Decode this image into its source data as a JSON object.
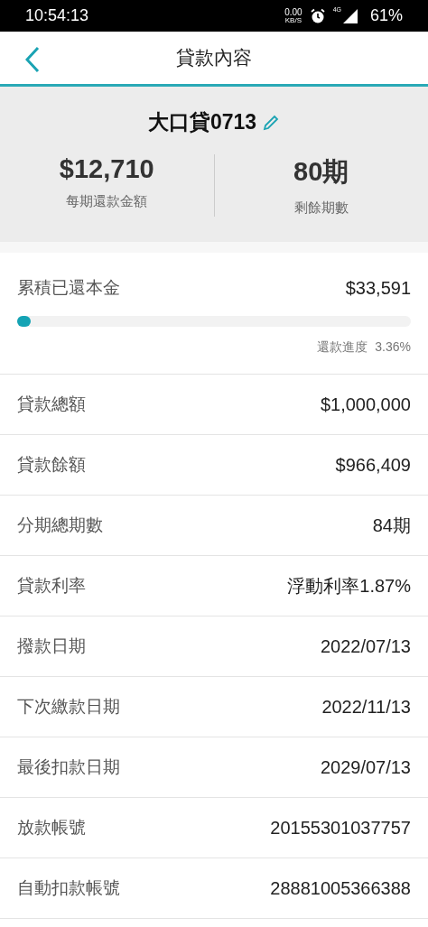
{
  "status_bar": {
    "time": "10:54:13",
    "net_speed": "0.00",
    "net_unit": "KB/S",
    "network": "4G",
    "battery": "61%"
  },
  "header": {
    "title": "貸款內容"
  },
  "summary": {
    "name": "大口貸0713",
    "stats": [
      {
        "value": "$12,710",
        "label": "每期還款金額"
      },
      {
        "value": "80期",
        "label": "剩餘期數"
      }
    ]
  },
  "principal": {
    "label": "累積已還本金",
    "value": "$33,591",
    "level": 0.0336,
    "progress_label": "還款進度",
    "progress_value": "3.36%"
  },
  "details": [
    {
      "label": "貸款總額",
      "value": "$1,000,000"
    },
    {
      "label": "貸款餘額",
      "value": "$966,409"
    },
    {
      "label": "分期總期數",
      "value": "84期"
    },
    {
      "label": "貸款利率",
      "value": "浮動利率1.87%"
    },
    {
      "label": "撥款日期",
      "value": "2022/07/13"
    },
    {
      "label": "下次繳款日期",
      "value": "2022/11/13"
    },
    {
      "label": "最後扣款日期",
      "value": "2029/07/13"
    },
    {
      "label": "放款帳號",
      "value": "20155301037757"
    },
    {
      "label": "自動扣款帳號",
      "value": "28881005366388"
    }
  ]
}
